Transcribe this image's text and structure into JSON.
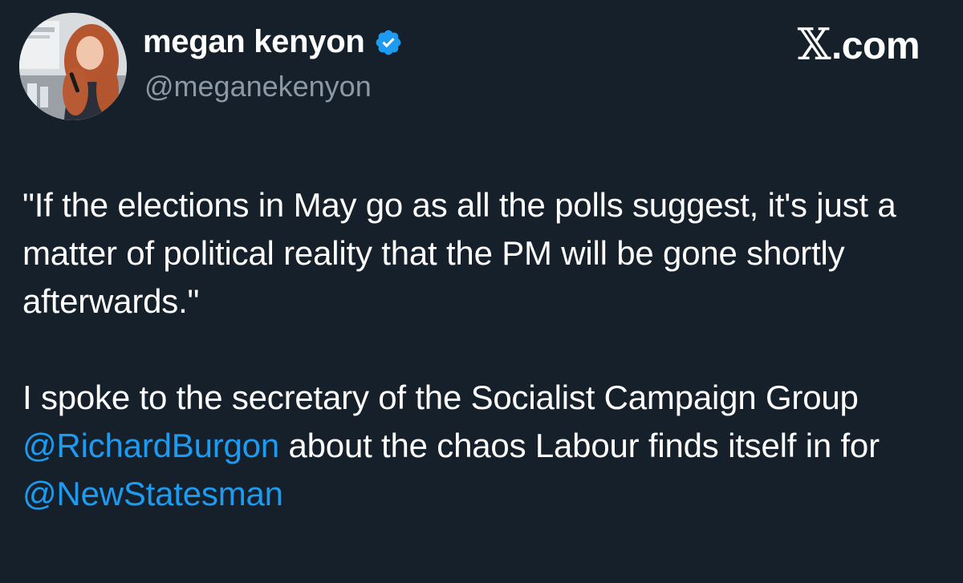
{
  "author": {
    "display_name": "megan kenyon",
    "handle": "@meganekenyon",
    "verified": true,
    "avatar_icon": "profile-photo"
  },
  "brand": {
    "x_mark": "𝕏",
    "domain": ".com"
  },
  "tweet": {
    "paragraph1": "\"If the elections in May go as all the polls suggest, it's just a matter of political reality that the PM will be gone shortly afterwards.\"",
    "paragraph2": {
      "text1": "I spoke to the secretary of the Socialist Campaign Group ",
      "mention1": "@RichardBurgon",
      "text2": " about the chaos Labour finds itself in for ",
      "mention2": "@NewStatesman"
    }
  },
  "colors": {
    "background": "#15202b",
    "text": "#ffffff",
    "secondary_text": "#8b98a5",
    "link": "#1d9bf0",
    "verified_badge": "#1d9bf0"
  }
}
